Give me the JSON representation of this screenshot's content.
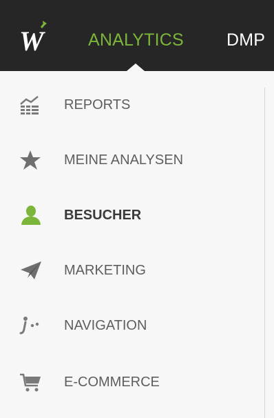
{
  "header": {
    "logo_text": "W",
    "tabs": [
      {
        "label": "ANALYTICS",
        "active": true
      },
      {
        "label": "DMP",
        "active": false
      }
    ]
  },
  "sidebar": {
    "items": [
      {
        "label": "REPORTS",
        "icon": "reports-icon",
        "active": false
      },
      {
        "label": "MEINE ANALYSEN",
        "icon": "star-icon",
        "active": false
      },
      {
        "label": "BESUCHER",
        "icon": "user-icon",
        "active": true
      },
      {
        "label": "MARKETING",
        "icon": "paper-plane-icon",
        "active": false
      },
      {
        "label": "NAVIGATION",
        "icon": "navigation-icon",
        "active": false
      },
      {
        "label": "E-COMMERCE",
        "icon": "cart-icon",
        "active": false
      }
    ]
  },
  "colors": {
    "topbar_bg": "#262626",
    "accent": "#7bb63a",
    "sidebar_bg": "#f7f7f7",
    "icon_gray": "#7a7a7a",
    "text_gray": "#5e5e5e"
  }
}
